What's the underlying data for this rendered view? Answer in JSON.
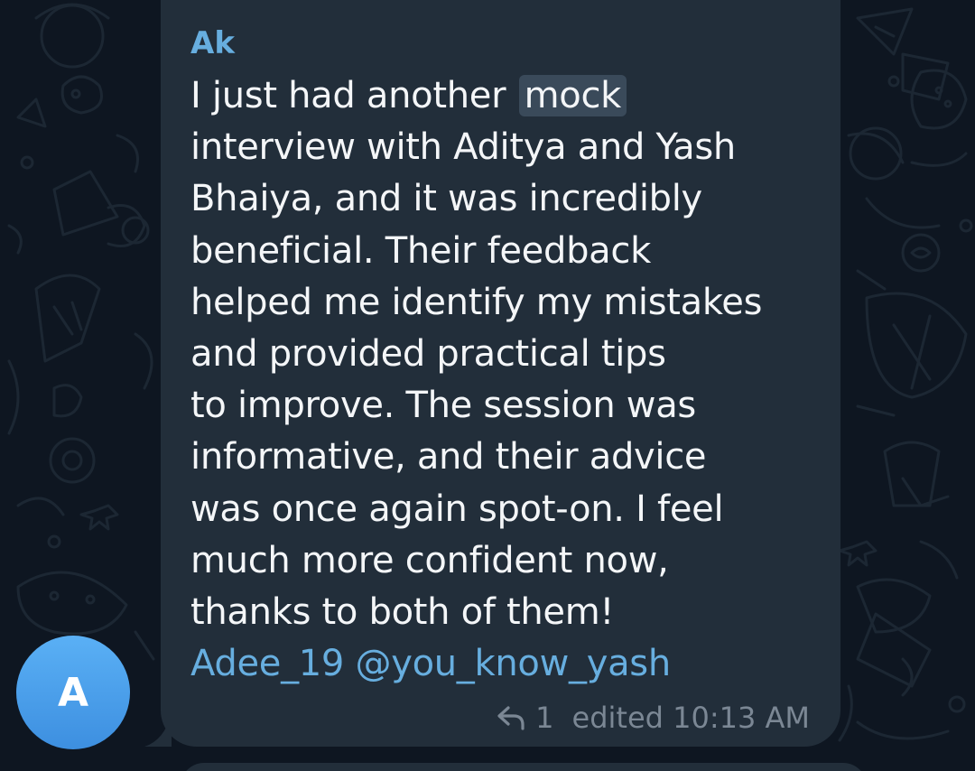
{
  "message": {
    "sender": "Ak",
    "text_lines": [
      "I just had another ",
      "interview with Aditya and Yash",
      "Bhaiya, and it was incredibly",
      "beneficial. Their feedback",
      "helped me identify my mistakes",
      "and provided practical tips",
      "to improve. The session was",
      "informative, and their advice",
      "was once again spot-on. I feel",
      "much more confident now,",
      "thanks to both of them!"
    ],
    "highlighted_word": "mock",
    "mentions": [
      "Adee_19",
      "@you_know_yash"
    ],
    "reply_count": "1",
    "edited_label": "edited",
    "time": "10:13 AM"
  },
  "avatar": {
    "initial": "A",
    "colors": [
      "#5ab0f5",
      "#3d8fe0"
    ]
  },
  "icons": {
    "reply": "reply-arrow-icon"
  },
  "colors": {
    "background": "#0e1621",
    "bubble": "#222e3a",
    "accent": "#67aedf",
    "text": "#f4f6f8",
    "meta": "#7b8794"
  }
}
